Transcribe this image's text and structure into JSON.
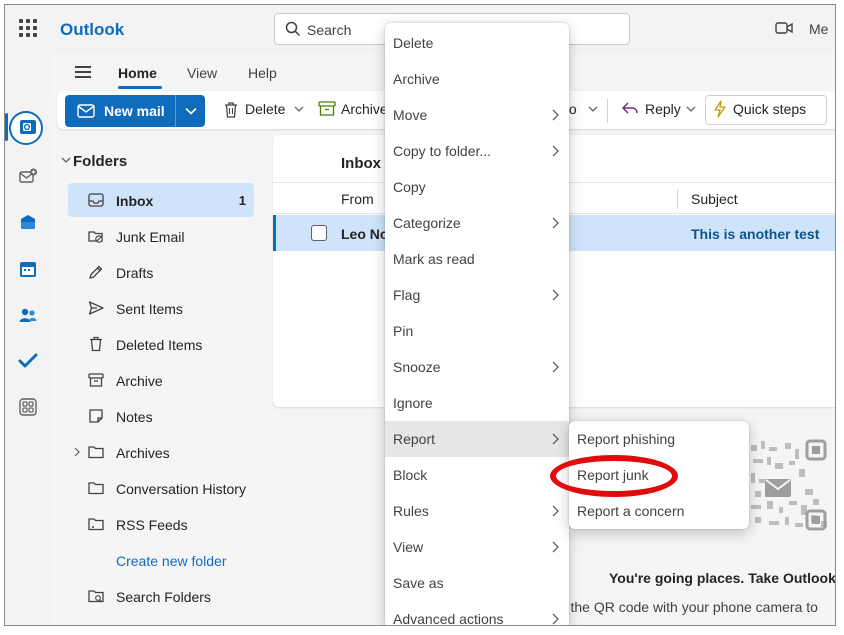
{
  "app": {
    "title": "Outlook",
    "search_placeholder": "Search",
    "meet_label": "Me"
  },
  "ribbon": {
    "tabs": [
      {
        "label": "Home"
      },
      {
        "label": "View"
      },
      {
        "label": "Help"
      }
    ],
    "new_mail": "New mail",
    "delete": "Delete",
    "archive": "Archive",
    "moveto_fragment": "to",
    "reply": "Reply",
    "quick_steps": "Quick steps"
  },
  "folders": {
    "header": "Folders",
    "items": [
      {
        "label": "Inbox",
        "icon": "inbox-icon",
        "count": "1"
      },
      {
        "label": "Junk Email",
        "icon": "junk-icon"
      },
      {
        "label": "Drafts",
        "icon": "pencil-icon"
      },
      {
        "label": "Sent Items",
        "icon": "send-icon"
      },
      {
        "label": "Deleted Items",
        "icon": "trash-icon"
      },
      {
        "label": "Archive",
        "icon": "archive-icon"
      },
      {
        "label": "Notes",
        "icon": "note-icon"
      },
      {
        "label": "Archives",
        "icon": "folder-icon"
      },
      {
        "label": "Conversation History",
        "icon": "folder-icon"
      },
      {
        "label": "RSS Feeds",
        "icon": "rss-folder-icon"
      },
      {
        "label": "Search Folders",
        "icon": "search-folder-icon"
      }
    ],
    "create_new": "Create new folder"
  },
  "message_list": {
    "title": "Inbox",
    "col_from": "From",
    "col_subject": "Subject",
    "row": {
      "sender": "Leo No",
      "subject": "This is another test"
    }
  },
  "context_menu": {
    "items": [
      {
        "label": "Delete",
        "submenu": false
      },
      {
        "label": "Archive",
        "submenu": false
      },
      {
        "label": "Move",
        "submenu": true
      },
      {
        "label": "Copy to folder...",
        "submenu": true
      },
      {
        "label": "Copy",
        "submenu": false
      },
      {
        "label": "Categorize",
        "submenu": true
      },
      {
        "label": "Mark as read",
        "submenu": false
      },
      {
        "label": "Flag",
        "submenu": true
      },
      {
        "label": "Pin",
        "submenu": false
      },
      {
        "label": "Snooze",
        "submenu": true
      },
      {
        "label": "Ignore",
        "submenu": false
      },
      {
        "label": "Report",
        "submenu": true
      },
      {
        "label": "Block",
        "submenu": false
      },
      {
        "label": "Rules",
        "submenu": true
      },
      {
        "label": "View",
        "submenu": true
      },
      {
        "label": "Save as",
        "submenu": false
      },
      {
        "label": "Advanced actions",
        "submenu": true
      }
    ],
    "report_submenu": [
      {
        "label": "Report phishing"
      },
      {
        "label": "Report junk"
      },
      {
        "label": "Report a concern"
      }
    ]
  },
  "promo": {
    "title": "You're going places. Take Outlook w",
    "subtitle": "an the QR code with your phone camera to"
  },
  "colors": {
    "accent": "#0f6cbd",
    "selected": "#cfe4fa",
    "annotation": "#e10b0b"
  }
}
